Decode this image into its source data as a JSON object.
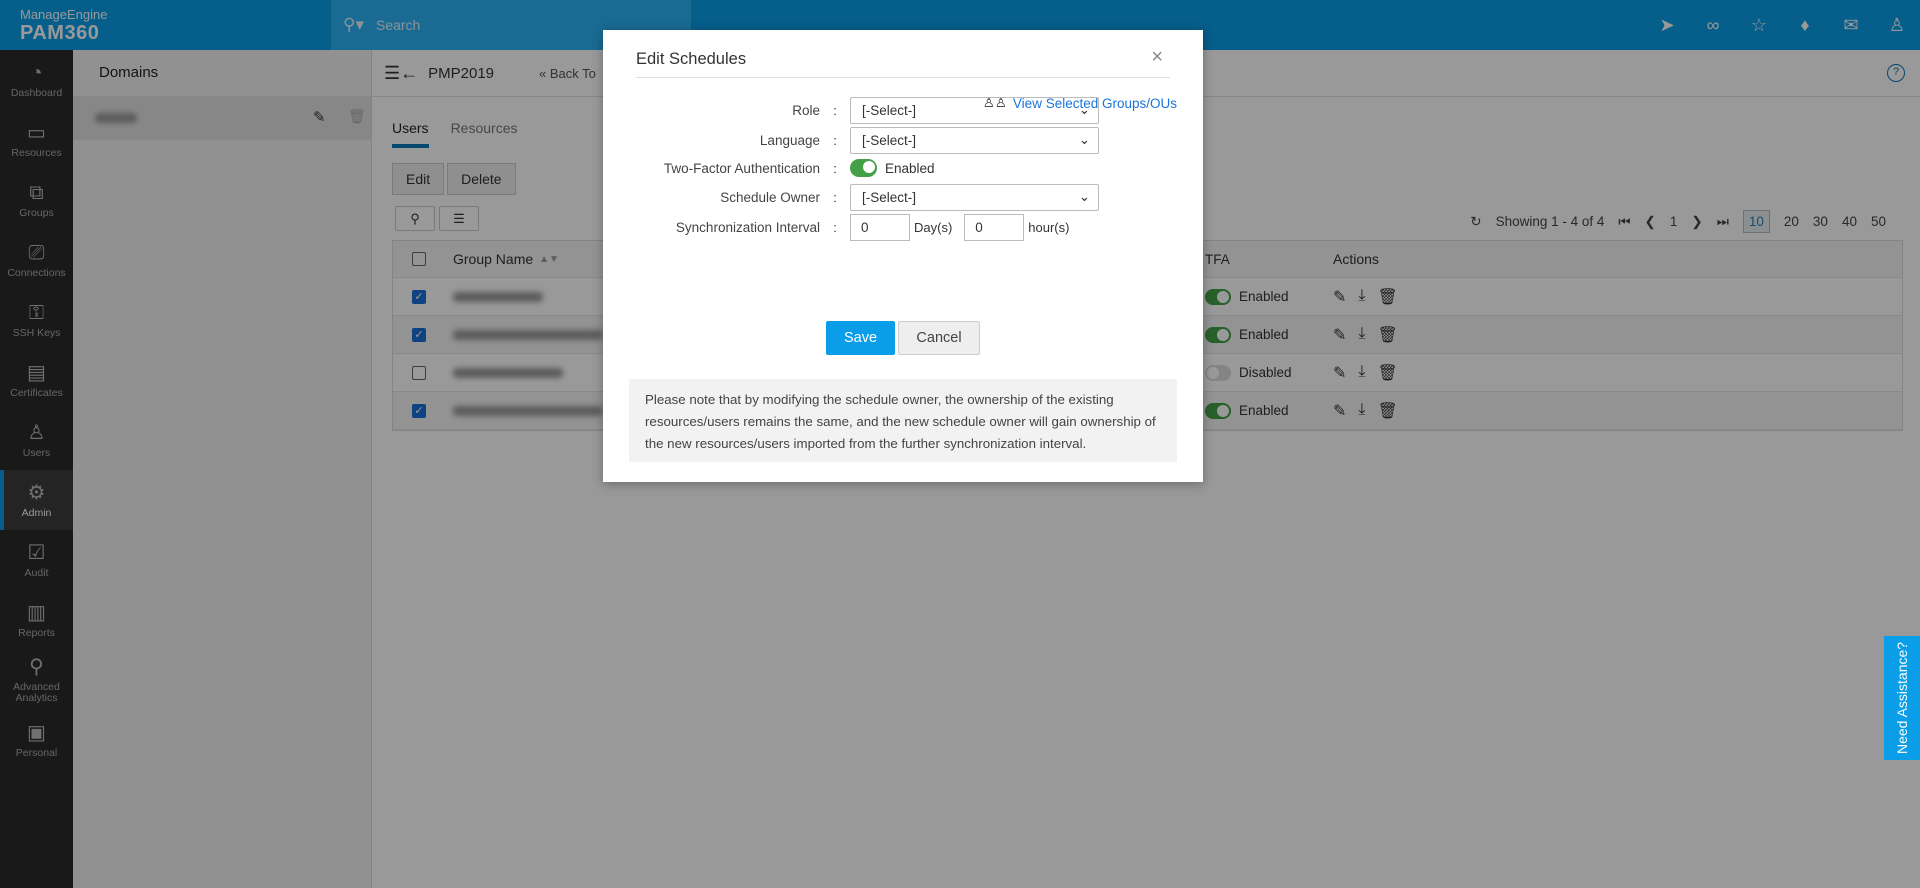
{
  "app": {
    "brand": "ManageEngine",
    "product": "PAM360",
    "search_placeholder": "Search"
  },
  "topbar_icons": [
    "rocket-icon",
    "link-icon",
    "user-star-icon",
    "bell-icon",
    "mail-icon",
    "user-icon"
  ],
  "sidebar": {
    "items": [
      {
        "label": "Dashboard",
        "icon": "◔"
      },
      {
        "label": "Resources",
        "icon": "▭"
      },
      {
        "label": "Groups",
        "icon": "⧉"
      },
      {
        "label": "Connections",
        "icon": "⎚"
      },
      {
        "label": "SSH Keys",
        "icon": "⚿"
      },
      {
        "label": "Certificates",
        "icon": "▤"
      },
      {
        "label": "Users",
        "icon": "♙"
      },
      {
        "label": "Admin",
        "icon": "⚙"
      },
      {
        "label": "Audit",
        "icon": "☑"
      },
      {
        "label": "Reports",
        "icon": "▥"
      },
      {
        "label": "Advanced Analytics",
        "icon": "⚲"
      },
      {
        "label": "Personal",
        "icon": "▣"
      }
    ],
    "active": "Admin"
  },
  "left_panel": {
    "title": "Domains"
  },
  "main": {
    "title": "PMP2019",
    "back_link": "« Back To",
    "tabs": [
      "Users",
      "Resources"
    ],
    "edit_label": "Edit",
    "delete_label": "Delete",
    "table": {
      "headers": {
        "group_name": "Group Name",
        "tfa": "TFA",
        "actions": "Actions"
      },
      "rows": [
        {
          "checked": true,
          "tfa": "Enabled"
        },
        {
          "checked": true,
          "tfa": "Enabled"
        },
        {
          "checked": false,
          "tfa": "Disabled"
        },
        {
          "checked": true,
          "tfa": "Enabled"
        }
      ]
    },
    "pagination": {
      "showing": "Showing 1 - 4 of 4",
      "page": "1",
      "sizes": [
        "10",
        "20",
        "30",
        "40",
        "50"
      ],
      "selected_size": "10"
    }
  },
  "modal": {
    "title": "Edit Schedules",
    "view_link": "View Selected Groups/OUs",
    "role_label": "Role",
    "role_value": "[-Select-]",
    "language_label": "Language",
    "language_value": "[-Select-]",
    "tfa_label": "Two-Factor Authentication",
    "tfa_value": "Enabled",
    "owner_label": "Schedule Owner",
    "owner_value": "[-Select-]",
    "sync_label": "Synchronization Interval",
    "sync_days": "0",
    "days_unit": "Day(s)",
    "sync_hours": "0",
    "hours_unit": "hour(s)",
    "save": "Save",
    "cancel": "Cancel",
    "note": "Please note that by modifying the schedule owner, the ownership of the existing resources/users remains the same, and the new schedule owner will gain ownership of the new resources/users imported from the further synchronization interval."
  },
  "assist": "Need Assistance?"
}
